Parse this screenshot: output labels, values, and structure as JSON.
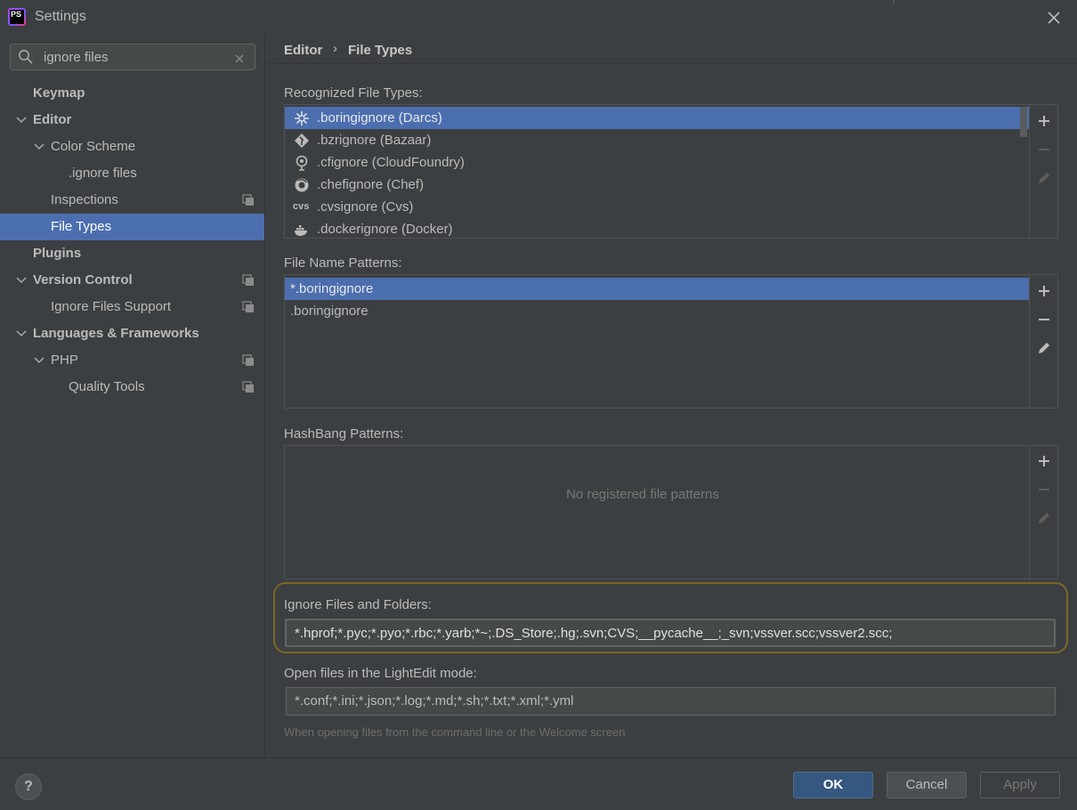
{
  "window": {
    "title": "Settings",
    "app_icon": "phpstorm-icon",
    "app_icon_text": "PS"
  },
  "search": {
    "value": "ignore files"
  },
  "sidebar": {
    "items": [
      {
        "label": "Keymap"
      },
      {
        "label": "Editor"
      },
      {
        "label": "Color Scheme"
      },
      {
        "label": ".ignore files"
      },
      {
        "label": "Inspections"
      },
      {
        "label": "File Types"
      },
      {
        "label": "Plugins"
      },
      {
        "label": "Version Control"
      },
      {
        "label": "Ignore Files Support"
      },
      {
        "label": "Languages & Frameworks"
      },
      {
        "label": "PHP"
      },
      {
        "label": "Quality Tools"
      }
    ]
  },
  "breadcrumb": {
    "parent": "Editor",
    "separator": "›",
    "current": "File Types"
  },
  "recognized": {
    "label": "Recognized File Types:",
    "rows": [
      {
        "text": ".boringignore (Darcs)",
        "icon": "darcs-icon"
      },
      {
        "text": ".bzrignore (Bazaar)",
        "icon": "bazaar-icon"
      },
      {
        "text": ".cfignore (CloudFoundry)",
        "icon": "cloudfoundry-icon"
      },
      {
        "text": ".chefignore (Chef)",
        "icon": "chef-icon"
      },
      {
        "text": ".cvsignore (Cvs)",
        "icon": "cvs-icon",
        "icon_text": "cvs"
      },
      {
        "text": ".dockerignore (Docker)",
        "icon": "docker-icon"
      }
    ]
  },
  "patterns": {
    "label": "File Name Patterns:",
    "rows": [
      {
        "text": "*.boringignore"
      },
      {
        "text": ".boringignore"
      }
    ]
  },
  "hashbang": {
    "label": "HashBang Patterns:",
    "empty": "No registered file patterns"
  },
  "ignore": {
    "label": "Ignore Files and Folders:",
    "value": "*.hprof;*.pyc;*.pyo;*.rbc;*.yarb;*~;.DS_Store;.hg;.svn;CVS;__pycache__;_svn;vssver.scc;vssver2.scc;"
  },
  "lightedit": {
    "label": "Open files in the LightEdit mode:",
    "value": "*.conf;*.ini;*.json;*.log;*.md;*.sh;*.txt;*.xml;*.yml",
    "hint": "When opening files from the command line or the Welcome screen"
  },
  "buttons": {
    "help": "?",
    "ok": "OK",
    "cancel": "Cancel",
    "apply": "Apply"
  },
  "colors": {
    "selection": "#4b6eaf",
    "ok_button": "#365880",
    "highlight_frame": "#7d6428"
  }
}
